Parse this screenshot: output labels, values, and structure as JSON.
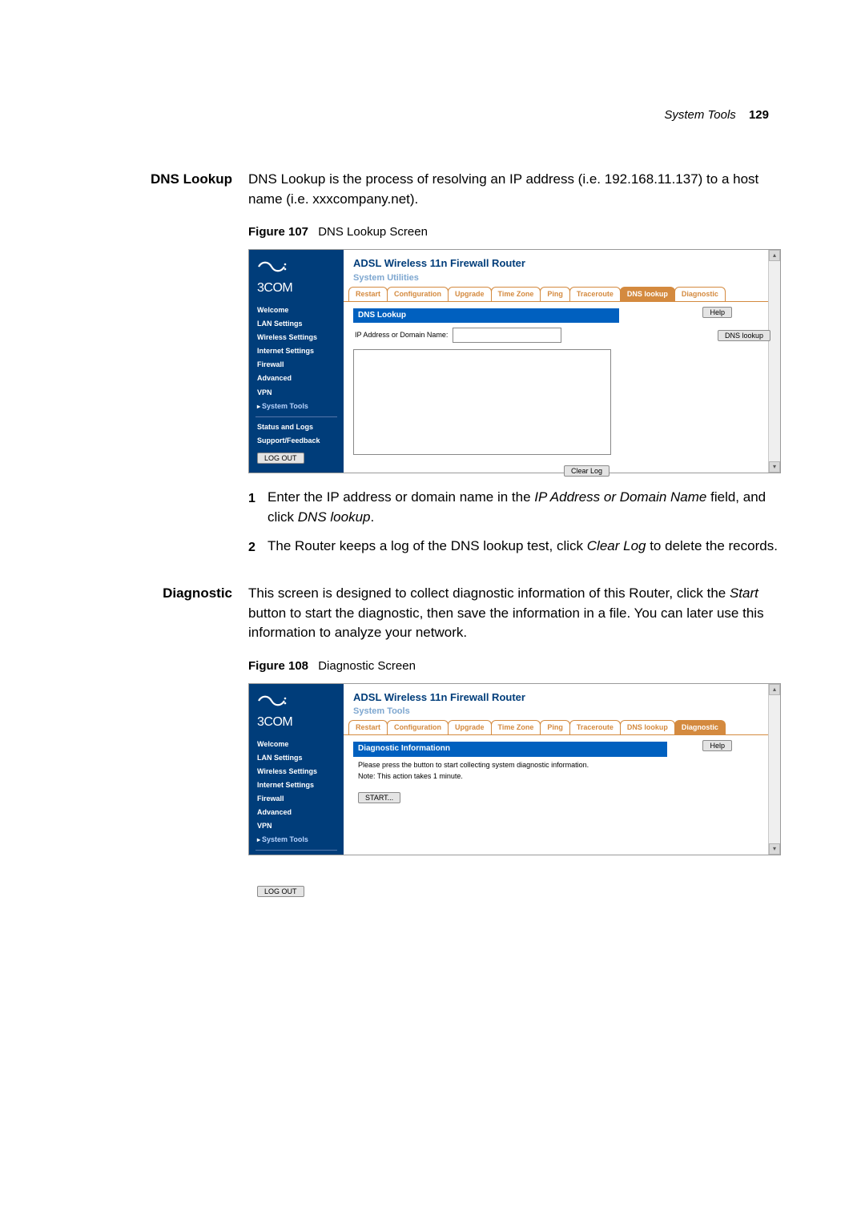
{
  "page_header": {
    "section": "System Tools",
    "page_number": "129"
  },
  "dns_lookup": {
    "heading": "DNS Lookup",
    "paragraph": "DNS Lookup is the process of resolving an IP address (i.e. 192.168.11.137) to a host name (i.e. xxxcompany.net).",
    "figure": {
      "label": "Figure 107",
      "caption": "DNS Lookup Screen"
    },
    "steps": [
      {
        "pre": "Enter the IP address or domain name in the ",
        "em1": "IP Address or Domain Name",
        "mid": " field, and click ",
        "em2": "DNS lookup",
        "post": "."
      },
      {
        "pre": "The Router keeps a log of the DNS lookup test, click ",
        "em1": "Clear Log",
        "mid": " to delete the records.",
        "em2": "",
        "post": ""
      }
    ]
  },
  "diagnostic": {
    "heading": "Diagnostic",
    "paragraph_pre": "This screen is designed to collect diagnostic information of this Router, click the ",
    "paragraph_em": "Start",
    "paragraph_post": " button to start the diagnostic, then save the information in a file. You can later use this information to analyze your network.",
    "figure": {
      "label": "Figure 108",
      "caption": "Diagnostic Screen"
    }
  },
  "router": {
    "brand": "3COM",
    "title": "ADSL Wireless 11n Firewall Router",
    "subtitle_dns": "System Utilities",
    "subtitle_diag": "System Tools",
    "nav": [
      "Welcome",
      "LAN Settings",
      "Wireless Settings",
      "Internet Settings",
      "Firewall",
      "Advanced",
      "VPN",
      "System Tools"
    ],
    "nav_bottom": [
      "Status and Logs",
      "Support/Feedback"
    ],
    "logout": "LOG OUT",
    "tabs": [
      "Restart",
      "Configuration",
      "Upgrade",
      "Time Zone",
      "Ping",
      "Traceroute",
      "DNS lookup",
      "Diagnostic"
    ],
    "help": "Help",
    "dns_panel": {
      "title": "DNS Lookup",
      "field_label": "IP Address or Domain Name:",
      "lookup_btn": "DNS lookup",
      "clear_btn": "Clear Log"
    },
    "diag_panel": {
      "title": "Diagnostic Informationn",
      "line1": "Please press the button to start collecting system diagnostic information.",
      "line2": "Note: This action takes 1 minute.",
      "start_btn": "START..."
    }
  }
}
